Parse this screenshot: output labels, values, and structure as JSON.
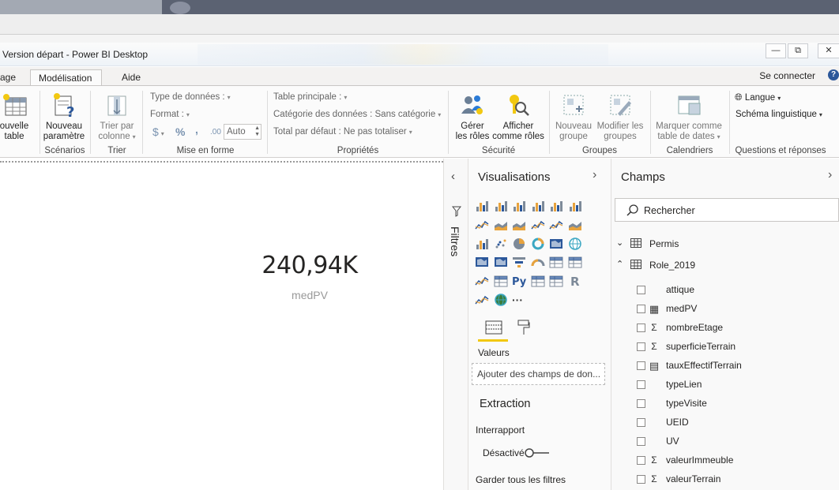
{
  "window": {
    "title": "Version départ - Power BI Desktop",
    "controls": {
      "minimize": "—",
      "restore": "⧉",
      "close": "✕"
    }
  },
  "tabs": {
    "items": [
      {
        "label": "age"
      },
      {
        "label": "Modélisation",
        "active": true
      },
      {
        "label": "Aide"
      }
    ],
    "signin": "Se connecter",
    "help": "?"
  },
  "ribbon": {
    "calculs": {
      "new_table_l1": "ouvelle",
      "new_table_l2": "table"
    },
    "scenarios": {
      "new_param_l1": "Nouveau",
      "new_param_l2": "paramètre",
      "label": "Scénarios"
    },
    "trier": {
      "sort_l1": "Trier par",
      "sort_l2": "colonne",
      "label": "Trier"
    },
    "format": {
      "data_type": "Type de données :",
      "format": "Format :",
      "currency": "$",
      "percent": "%",
      "comma": ",",
      "decimals": ".00",
      "auto": "Auto",
      "label": "Mise en forme"
    },
    "proprietes": {
      "home_table": "Table principale :",
      "data_category": "Catégorie des données : Sans catégorie",
      "default_summary": "Total par défaut : Ne pas totaliser",
      "label": "Propriétés"
    },
    "securite": {
      "manage_l1": "Gérer",
      "manage_l2": "les rôles",
      "view_l1": "Afficher",
      "view_l2": "comme rôles",
      "label": "Sécurité"
    },
    "groupes": {
      "new_l1": "Nouveau",
      "new_l2": "groupe",
      "edit_l1": "Modifier les",
      "edit_l2": "groupes",
      "label": "Groupes"
    },
    "calendriers": {
      "mark_l1": "Marquer comme",
      "mark_l2": "table de dates",
      "label": "Calendriers"
    },
    "qa": {
      "language": "Langue",
      "schema": "Schéma linguistique",
      "label": "Questions et réponses"
    }
  },
  "card": {
    "value": "240,94K",
    "label": "medPV"
  },
  "filters": {
    "label": "Filtres"
  },
  "visualisations": {
    "title": "Visualisations",
    "more": "···",
    "values_label": "Valeurs",
    "drop_placeholder": "Ajouter des champs de don...",
    "extraction_title": "Extraction",
    "cross_report": "Interrapport",
    "toggle_state": "Désactivé",
    "keep_filters": "Garder tous les filtres"
  },
  "champs": {
    "title": "Champs",
    "search_placeholder": "Rechercher",
    "tables": [
      {
        "name": "Permis",
        "expanded": false
      },
      {
        "name": "Role_2019",
        "expanded": true
      }
    ],
    "fields": [
      {
        "name": "attique",
        "icon": ""
      },
      {
        "name": "medPV",
        "icon": "calculator-icon"
      },
      {
        "name": "nombreEtage",
        "icon": "sigma-icon"
      },
      {
        "name": "superficieTerrain",
        "icon": "sigma-icon"
      },
      {
        "name": "tauxEffectifTerrain",
        "icon": "table-calc-icon"
      },
      {
        "name": "typeLien",
        "icon": ""
      },
      {
        "name": "typeVisite",
        "icon": ""
      },
      {
        "name": "UEID",
        "icon": ""
      },
      {
        "name": "UV",
        "icon": ""
      },
      {
        "name": "valeurImmeuble",
        "icon": "sigma-icon"
      },
      {
        "name": "valeurTerrain",
        "icon": "sigma-icon"
      }
    ]
  },
  "colors": {
    "accent_yellow": "#f2c811",
    "ribbon_bg": "#fbfbfb",
    "blue_icon": "#2b579a"
  }
}
